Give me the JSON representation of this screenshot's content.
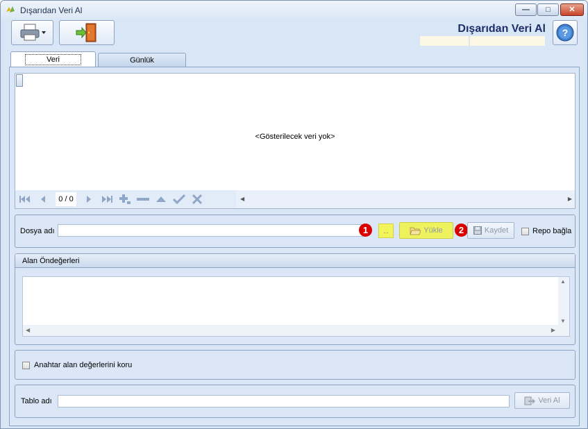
{
  "window": {
    "title": "Dışarıdan Veri Al",
    "min_glyph": "—",
    "max_glyph": "□",
    "close_glyph": "✕"
  },
  "header": {
    "title": "Dışarıdan Veri Al"
  },
  "tabs": [
    {
      "label": "Veri",
      "active": true
    },
    {
      "label": "Günlük",
      "active": false
    }
  ],
  "grid": {
    "empty_text": "<Gösterilecek veri yok>",
    "record_count": "0 / 0"
  },
  "dosya": {
    "label": "Dosya adı",
    "value": "",
    "browse_label": "...",
    "load_label": "Yükle",
    "save_label": "Kaydet",
    "repo_label": "Repo bağla",
    "badge1": "1",
    "badge2": "2"
  },
  "alan": {
    "header": "Alan Öndeğerleri"
  },
  "anahtar": {
    "label": "Anahtar alan değerlerini koru"
  },
  "tablo": {
    "label": "Tablo adı",
    "value": "",
    "button_label": "Veri Al"
  },
  "colors": {
    "highlight": "#f3f35a",
    "badge": "#d90000",
    "header_title": "#1e2e6a"
  }
}
